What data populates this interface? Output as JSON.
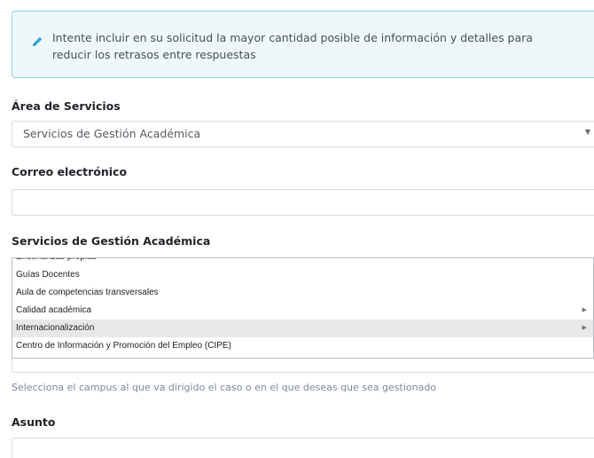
{
  "notice": {
    "icon": "pencil-icon",
    "text": "Intente incluir en su solicitud la mayor cantidad posible de información y detalles para reducir los retrasos entre respuestas",
    "accent": "#29a9d8"
  },
  "service_area": {
    "label": "Área de Servicios",
    "value": "Servicios de Gestión Académica"
  },
  "email": {
    "label": "Correo electrónico",
    "value": ""
  },
  "academic_services": {
    "label": "Servicios de Gestión Académica",
    "options": [
      "Enseñanzas propias",
      "Guías Docentes",
      "Aula de competencias transversales",
      "Calidad académica",
      "Internacionalización",
      "Centro de Información y Promoción del Empleo (CIPE)"
    ],
    "highlighted": "Internacionalización"
  },
  "campus": {
    "helper": "Selecciona el campus al que va dirigido el caso o en el que deseas que sea gestionado"
  },
  "subject": {
    "label": "Asunto",
    "value": ""
  }
}
